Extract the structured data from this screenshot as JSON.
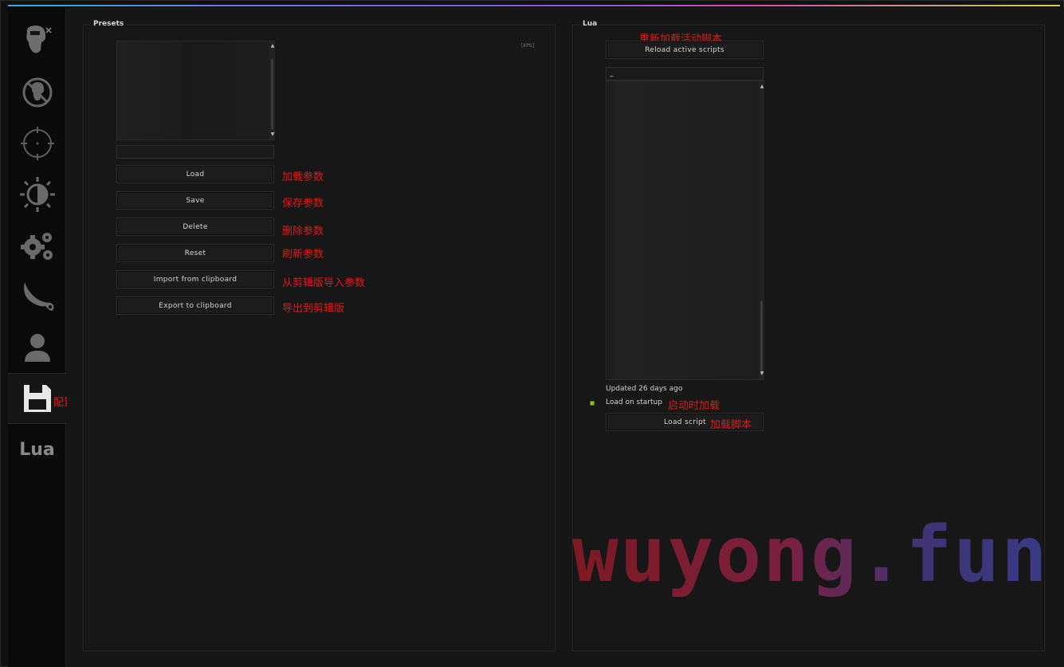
{
  "sidebar": {
    "tabs": [
      {
        "name": "rage-tab",
        "icon": "head-crosshair-icon"
      },
      {
        "name": "anti-aim-tab",
        "icon": "no-head-icon"
      },
      {
        "name": "legit-tab",
        "icon": "crosshair-icon"
      },
      {
        "name": "visuals-tab",
        "icon": "brightness-icon"
      },
      {
        "name": "misc-tab",
        "icon": "gears-icon"
      },
      {
        "name": "skins-tab",
        "icon": "karambit-icon"
      },
      {
        "name": "players-tab",
        "icon": "person-icon"
      },
      {
        "name": "config-tab",
        "icon": "floppy-disk-icon"
      },
      {
        "name": "lua-tab",
        "label": "Lua"
      }
    ],
    "config_annotation": "配置"
  },
  "presets": {
    "title": "Presets",
    "kps_tag": "[KPS]",
    "name_input_value": "",
    "buttons": [
      {
        "label": "Load",
        "annotation": "加载参数"
      },
      {
        "label": "Save",
        "annotation": "保存参数"
      },
      {
        "label": "Delete",
        "annotation": "删除参数"
      },
      {
        "label": "Reset",
        "annotation": "刷新参数"
      },
      {
        "label": "Import from clipboard",
        "annotation": "从剪辑版导入参数"
      },
      {
        "label": "Export to clipboard",
        "annotation": "导出到剪辑版"
      }
    ]
  },
  "lua": {
    "title": "Lua",
    "reload_annotation": "重新加载活动脚本",
    "reload_label": "Reload active scripts",
    "search_value": "_",
    "updated_text": "Updated 26 days ago",
    "load_on_startup_label": "Load on startup",
    "load_on_startup_checked": true,
    "load_on_startup_annotation": "启动时加载",
    "load_script_label": "Load script",
    "load_script_annotation": "加载脚本"
  },
  "watermark": "wuyong.fun",
  "colors": {
    "annotation": "#e01a1a",
    "checkbox_on": "#8fbf2a"
  }
}
